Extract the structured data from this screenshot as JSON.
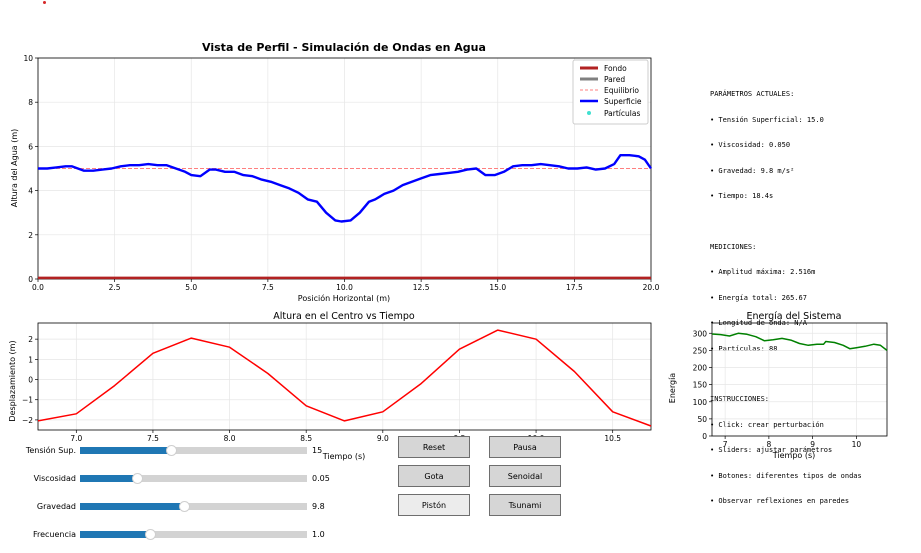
{
  "chart_data": [
    {
      "type": "line",
      "title": "Vista de Perfil - Simulación de Ondas en Agua",
      "xlabel": "Posición Horizontal (m)",
      "ylabel": "Altura del Agua (m)",
      "xlim": [
        0,
        20
      ],
      "ylim": [
        0,
        10
      ],
      "xticks": [
        "0.0",
        "2.5",
        "5.0",
        "7.5",
        "10.0",
        "12.5",
        "15.0",
        "17.5",
        "20.0"
      ],
      "yticks": [
        "0",
        "2",
        "4",
        "6",
        "8",
        "10"
      ],
      "grid": true,
      "legend_position": "top-right",
      "legend": [
        "Fondo",
        "Pared",
        "Equilibrio",
        "Superficie",
        "Partículas"
      ],
      "series": [
        {
          "name": "Fondo",
          "color": "#b22222",
          "x": [
            0,
            20
          ],
          "y": [
            0.05,
            0.05
          ]
        },
        {
          "name": "Equilibrio",
          "color": "#ff7f7f",
          "x": [
            0,
            20
          ],
          "y": [
            5.0,
            5.0
          ]
        },
        {
          "name": "Superficie",
          "color": "#0000ff",
          "x": [
            0.0,
            0.3,
            0.6,
            0.9,
            1.1,
            1.5,
            1.8,
            2.1,
            2.4,
            2.7,
            3.0,
            3.3,
            3.6,
            3.9,
            4.2,
            4.5,
            4.8,
            5.0,
            5.3,
            5.6,
            5.8,
            6.1,
            6.4,
            6.7,
            7.0,
            7.3,
            7.6,
            7.9,
            8.2,
            8.5,
            8.8,
            9.1,
            9.4,
            9.7,
            9.9,
            10.2,
            10.5,
            10.8,
            11.0,
            11.3,
            11.6,
            11.9,
            12.2,
            12.5,
            12.8,
            13.1,
            13.4,
            13.7,
            14.0,
            14.3,
            14.6,
            14.9,
            15.2,
            15.5,
            15.8,
            16.1,
            16.4,
            16.7,
            17.0,
            17.3,
            17.6,
            17.9,
            18.2,
            18.5,
            18.8,
            19.0,
            19.3,
            19.6,
            19.8,
            20.0
          ],
          "y": [
            5.0,
            5.0,
            5.05,
            5.1,
            5.1,
            4.9,
            4.9,
            4.95,
            5.0,
            5.1,
            5.15,
            5.15,
            5.2,
            5.15,
            5.15,
            5.0,
            4.85,
            4.7,
            4.65,
            4.95,
            4.95,
            4.85,
            4.85,
            4.7,
            4.65,
            4.5,
            4.4,
            4.25,
            4.1,
            3.9,
            3.6,
            3.5,
            3.0,
            2.65,
            2.6,
            2.65,
            3.0,
            3.5,
            3.6,
            3.85,
            4.0,
            4.25,
            4.4,
            4.55,
            4.7,
            4.75,
            4.8,
            4.85,
            4.95,
            5.0,
            4.7,
            4.7,
            4.85,
            5.1,
            5.15,
            5.15,
            5.2,
            5.15,
            5.1,
            5.0,
            5.0,
            5.05,
            4.95,
            5.0,
            5.2,
            5.6,
            5.6,
            5.55,
            5.4,
            5.0
          ]
        },
        {
          "name": "Partículas",
          "color": "#40e0d0",
          "x": [],
          "y": []
        }
      ]
    },
    {
      "type": "line",
      "title": "Altura en el Centro vs Tiempo",
      "xlabel": "Tiempo (s)",
      "ylabel": "Desplazamiento (m)",
      "xlim": [
        6.75,
        10.75
      ],
      "ylim": [
        -2.5,
        2.8
      ],
      "xticks": [
        "7.0",
        "7.5",
        "8.0",
        "8.5",
        "9.0",
        "9.5",
        "10.0",
        "10.5"
      ],
      "yticks": [
        "−2",
        "−1",
        "0",
        "1",
        "2"
      ],
      "grid": true,
      "series": [
        {
          "name": "",
          "color": "#ff0000",
          "x": [
            6.75,
            7.0,
            7.25,
            7.5,
            7.75,
            8.0,
            8.25,
            8.5,
            8.75,
            9.0,
            9.25,
            9.5,
            9.75,
            10.0,
            10.25,
            10.5,
            10.75
          ],
          "y": [
            -2.05,
            -1.7,
            -0.3,
            1.3,
            2.05,
            1.6,
            0.3,
            -1.3,
            -2.05,
            -1.6,
            -0.2,
            1.5,
            2.45,
            2.0,
            0.4,
            -1.6,
            -2.3
          ]
        }
      ]
    },
    {
      "type": "line",
      "title": "Energía del Sistema",
      "xlabel": "Tiempo (s)",
      "ylabel": "Energía",
      "xlim": [
        6.7,
        10.7
      ],
      "ylim": [
        0,
        330
      ],
      "xticks": [
        "7",
        "8",
        "9",
        "10"
      ],
      "yticks": [
        "0",
        "50",
        "100",
        "150",
        "200",
        "250",
        "300"
      ],
      "grid": true,
      "series": [
        {
          "name": "",
          "color": "#008000",
          "x": [
            6.7,
            6.9,
            7.1,
            7.3,
            7.5,
            7.7,
            7.9,
            8.1,
            8.3,
            8.5,
            8.7,
            8.9,
            9.1,
            9.25,
            9.3,
            9.5,
            9.7,
            9.85,
            10.0,
            10.2,
            10.4,
            10.55,
            10.7
          ],
          "y": [
            298,
            296,
            292,
            300,
            297,
            290,
            278,
            281,
            285,
            280,
            270,
            265,
            268,
            268,
            276,
            273,
            265,
            255,
            258,
            262,
            268,
            265,
            250
          ]
        }
      ]
    }
  ],
  "info": {
    "params_header": "PARÁMETROS ACTUALES:",
    "params": [
      "• Tensión Superficial: 15.0",
      "• Viscosidad: 0.050",
      "• Gravedad: 9.8 m/s²",
      "• Tiempo: 18.4s"
    ],
    "meas_header": "MEDICIONES:",
    "meas": [
      "• Amplitud máxima: 2.516m",
      "• Energía total: 265.67",
      "• Longitud de onda: N/A",
      "• Partículas: 88"
    ],
    "instr_header": "INSTRUCCIONES:",
    "instr": [
      "• Click: crear perturbación",
      "• Sliders: ajustar parámetros",
      "• Botones: diferentes tipos de ondas",
      "• Observar reflexiones en paredes"
    ]
  },
  "sliders": [
    {
      "label": "Tensión Sup.",
      "value_text": "15",
      "fraction": 0.4
    },
    {
      "label": "Viscosidad",
      "value_text": "0.05",
      "fraction": 0.25
    },
    {
      "label": "Gravedad",
      "value_text": "9.8",
      "fraction": 0.46
    },
    {
      "label": "Frecuencia",
      "value_text": "1.0",
      "fraction": 0.31
    }
  ],
  "buttons": {
    "reset": "Reset",
    "pausa": "Pausa",
    "gota": "Gota",
    "senoidal": "Senoidal",
    "piston": "Pistón",
    "tsunami": "Tsunami"
  },
  "colors": {
    "accent": "#1f77b4",
    "track": "#d3d3d3",
    "indicator_dot": "#d62728"
  }
}
